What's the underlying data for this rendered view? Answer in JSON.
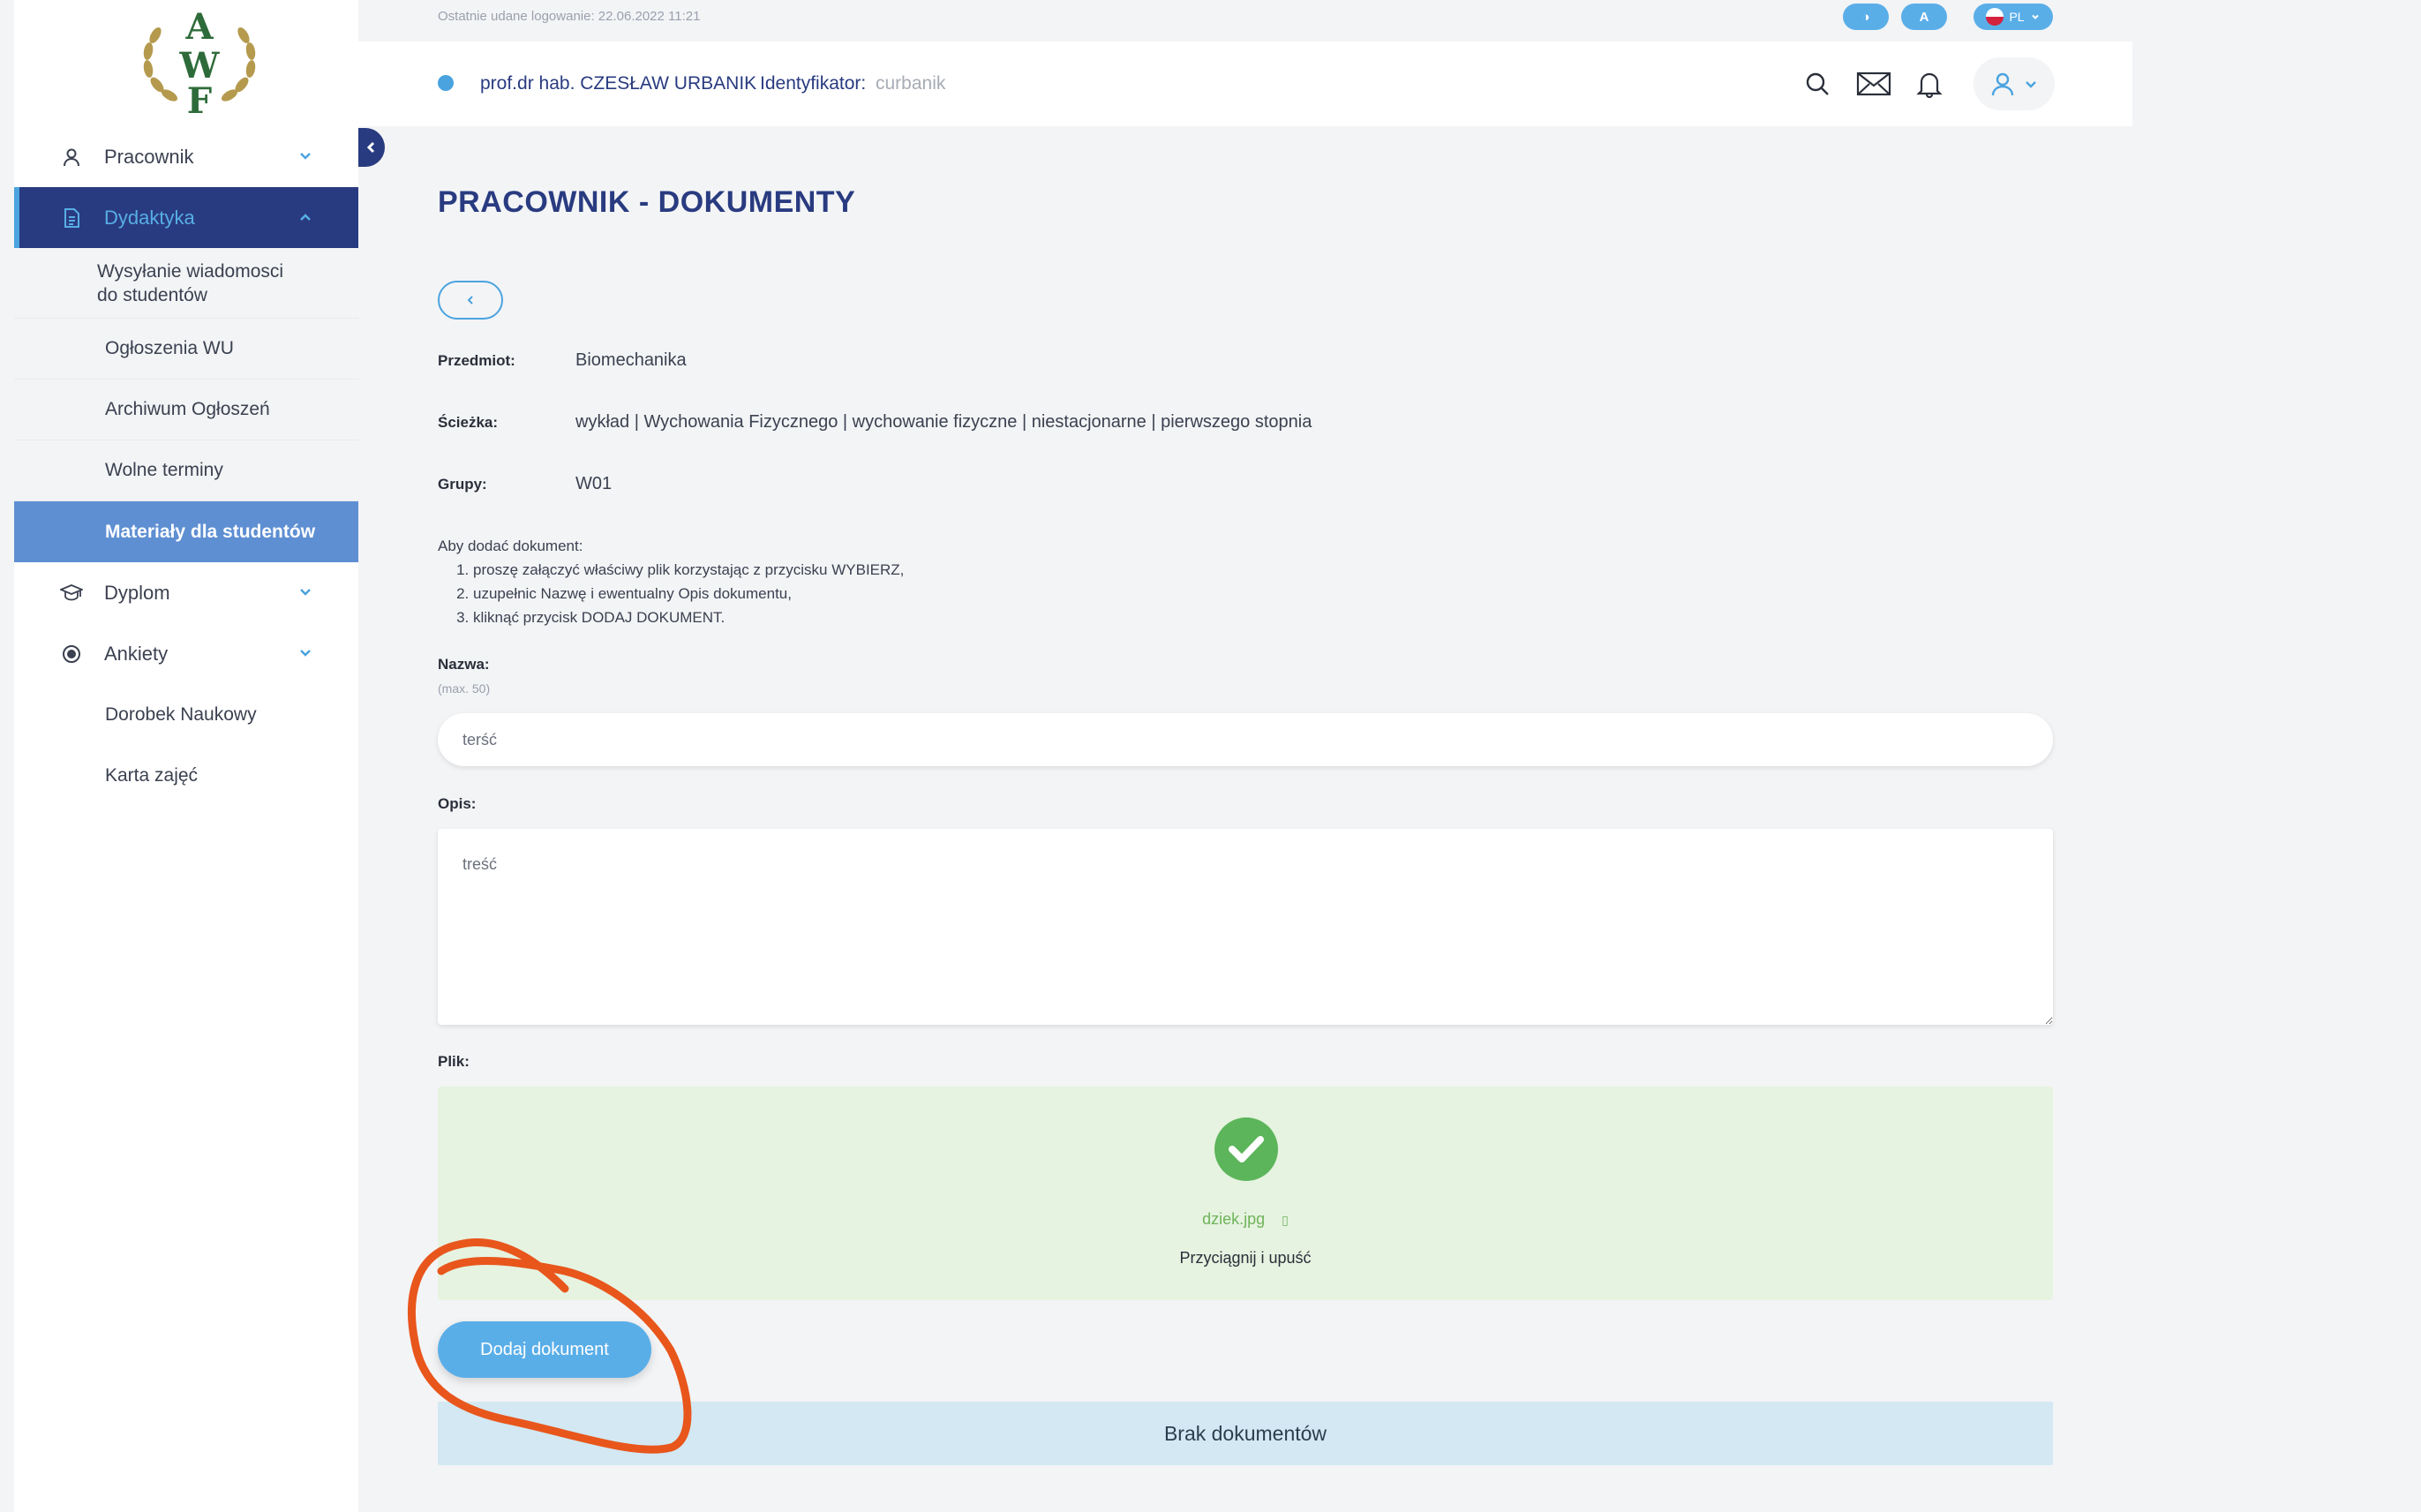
{
  "app": {
    "logo_alt": "AWF"
  },
  "sidebar": {
    "items": [
      {
        "label": "Pracownik",
        "icon": "user-icon"
      },
      {
        "label": "Dydaktyka",
        "icon": "document-icon",
        "active": true
      },
      {
        "label": "Dyplom",
        "icon": "graduation-cap-icon"
      },
      {
        "label": "Ankiety",
        "icon": "radio-circle-icon"
      },
      {
        "label": "Dorobek Naukowy"
      },
      {
        "label": "Karta zajęć"
      }
    ],
    "submenu": [
      {
        "label": "Wysyłanie wiadomosci do studentów"
      },
      {
        "label": "Ogłoszenia WU"
      },
      {
        "label": "Archiwum Ogłoszeń"
      },
      {
        "label": "Wolne terminy"
      },
      {
        "label": "Materiały dla studentów",
        "selected": true
      }
    ]
  },
  "topbar": {
    "last_login": "Ostatnie udane logowanie: 22.06.2022 11:21",
    "contrast_label": "◑",
    "font_label": "A",
    "language": "PL"
  },
  "header": {
    "user_name": "prof.dr hab. CZESŁAW URBANIK",
    "id_label": "Identyfikator:",
    "id_value": "curbanik"
  },
  "page": {
    "title": "PRACOWNIK - DOKUMENTY",
    "subject_label": "Przedmiot:",
    "subject_value": "Biomechanika",
    "path_label": "Ścieżka:",
    "path_value": "wykład | Wychowania Fizycznego | wychowanie fizyczne | niestacjonarne | pierwszego stopnia",
    "groups_label": "Grupy:",
    "groups_value": "W01",
    "instructions_intro": "Aby dodać dokument:",
    "instructions": [
      "proszę załączyć właściwy plik korzystając z przycisku WYBIERZ,",
      "uzupełnic Nazwę i ewentualny Opis dokumentu,",
      "kliknąć przycisk DODAJ DOKUMENT."
    ],
    "name_label": "Nazwa:",
    "name_hint": "(max. 50)",
    "name_value": "terść",
    "desc_label": "Opis:",
    "desc_value": "treść",
    "file_label": "Plik:",
    "file_name": "dziek.jpg",
    "file_remove": "▯",
    "dropzone_text": "Przyciągnij i upuść",
    "add_button": "Dodaj dokument",
    "no_documents": "Brak dokumentów"
  },
  "colors": {
    "navy": "#293b80",
    "accent_blue": "#5aaee8",
    "success_green": "#5cb55a",
    "annotation_orange": "#e8561c"
  }
}
